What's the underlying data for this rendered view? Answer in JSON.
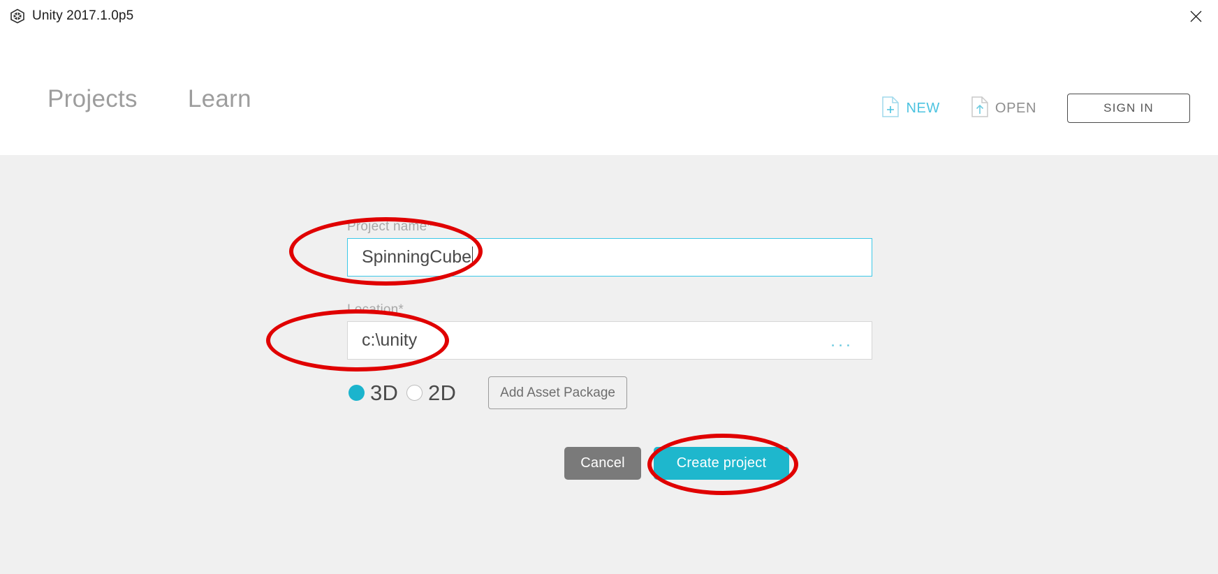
{
  "window": {
    "title": "Unity 2017.1.0p5",
    "logo_icon": "unity-logo-icon",
    "close_icon": "close-icon"
  },
  "header": {
    "tabs": [
      {
        "label": "Projects"
      },
      {
        "label": "Learn"
      }
    ],
    "actions": [
      {
        "label": "NEW",
        "icon": "document-plus-icon",
        "color": "#4cc3e0"
      },
      {
        "label": "OPEN",
        "icon": "document-upload-icon",
        "color": "#8e8e8e"
      }
    ],
    "sign_in_label": "SIGN IN"
  },
  "form": {
    "project_name": {
      "label": "Project name*",
      "value": "SpinningCube",
      "placeholder": "Project name"
    },
    "location": {
      "label": "Location*",
      "value": "c:\\unity",
      "placeholder": "Location",
      "browse_label": "...",
      "browse_icon": "ellipsis-icon"
    },
    "template": {
      "options": [
        {
          "label": "3D",
          "selected": true
        },
        {
          "label": "2D",
          "selected": false
        }
      ],
      "add_asset_package_label": "Add Asset Package"
    },
    "buttons": {
      "cancel_label": "Cancel",
      "create_label": "Create project"
    }
  },
  "annotations": {
    "color": "#e00000",
    "shapes": [
      {
        "name": "project-name-highlight"
      },
      {
        "name": "location-highlight"
      },
      {
        "name": "create-project-highlight"
      }
    ]
  },
  "colors": {
    "accent_cyan": "#1eb7cd",
    "focus_border": "#3cc8e8",
    "content_bg": "#f0f0f0",
    "header_bg": "#ffffff",
    "cancel_grey": "#7a7a7a"
  }
}
